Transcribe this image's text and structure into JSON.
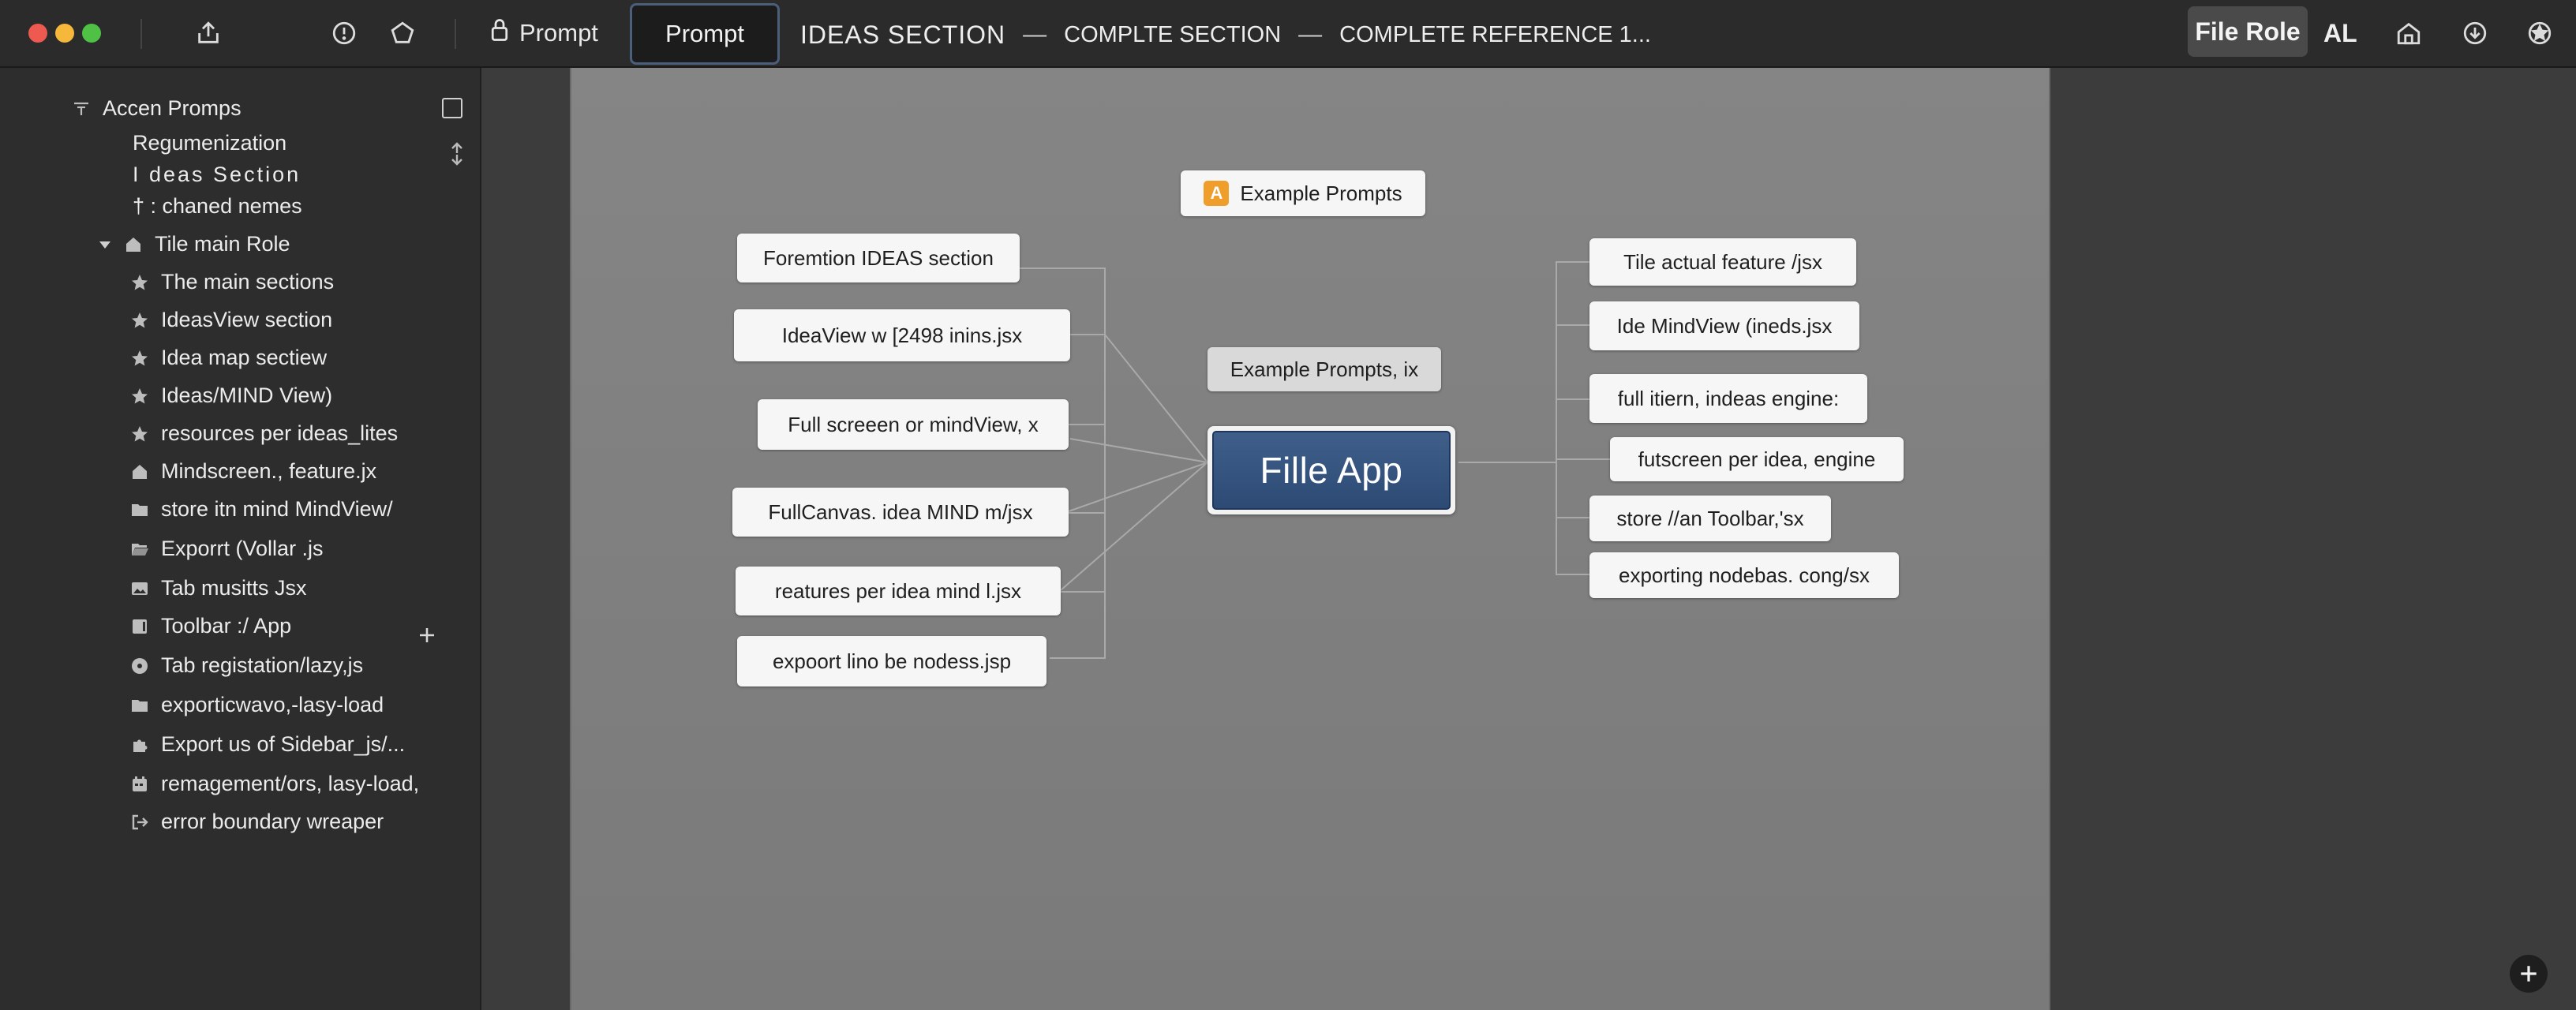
{
  "window": {
    "tabs": {
      "first": "Prompt",
      "second": "Prompt"
    },
    "breadcrumb": {
      "main": "IDEAS SECTION",
      "sep1": "—",
      "part2": "COMPLTE SECTION",
      "sep2": "—",
      "part3": "COMPLETE REFERENCE 1..."
    },
    "right": {
      "file_role": "File Role",
      "al": "AL"
    }
  },
  "sidebar": {
    "items": [
      {
        "label": "Accen Promps",
        "icon": "tree-icon"
      },
      {
        "label": "Regumenization",
        "icon": ""
      },
      {
        "label": "I deas Section",
        "icon": ""
      },
      {
        "label": "† :  chaned nemes",
        "icon": ""
      },
      {
        "label": "Tile main Role",
        "icon": "home-icon"
      },
      {
        "label": "The main sections",
        "icon": "star-icon"
      },
      {
        "label": "IdeasView section",
        "icon": "star-icon"
      },
      {
        "label": "Idea map sectiew",
        "icon": "star-icon"
      },
      {
        "label": "Ideas/MIND View)",
        "icon": "star-icon"
      },
      {
        "label": "resources per ideas_lites",
        "icon": "star-icon"
      },
      {
        "label": "Mindscreen., feature.jx",
        "icon": "home-icon"
      },
      {
        "label": "store itn mind MindView/",
        "icon": "folder-icon"
      },
      {
        "label": "Exporrt (Vollar .js",
        "icon": "folder-open-icon"
      },
      {
        "label": "Tab musitts Jsx",
        "icon": "image-icon"
      },
      {
        "label": "Toolbar :/ App",
        "icon": "toolbar-icon"
      },
      {
        "label": "Tab registation/lazy,js",
        "icon": "disc-icon"
      },
      {
        "label": "exporticwavo,-lasy-load",
        "icon": "folder-icon"
      },
      {
        "label": "Export us of Sidebar_js/...",
        "icon": "puzzle-icon"
      },
      {
        "label": "remagement/ors, lasy-load,",
        "icon": "calendar-icon"
      },
      {
        "label": "error boundary wreaper",
        "icon": "exit-icon"
      }
    ]
  },
  "mindmap": {
    "central": "Fille App",
    "top": "Example Prompts",
    "mid": "Example Prompts, ix",
    "left": [
      "Foremtion IDEAS section",
      "IdeaView w [2498 inins.jsx",
      "Full screeen or mindView, x",
      "FullCanvas. idea MIND m/jsx",
      "reatures per idea mind l.jsx",
      "expoort lino be nodess.jsp"
    ],
    "right": [
      "Tile actual feature /jsx",
      "Ide MindView (ineds.jsx",
      "full itiern, indeas engine:",
      "futscreen per idea, engine",
      "store //an Toolbar,'sx",
      "exporting nodebas. cong/sx"
    ]
  },
  "colors": {
    "accent_tab_border": "#4b5f7a",
    "central_node": "#2c4a74",
    "badge": "#ef9d2b",
    "traffic_red": "#ee5a50",
    "traffic_yellow": "#f5b83b",
    "traffic_green": "#4fc245"
  }
}
